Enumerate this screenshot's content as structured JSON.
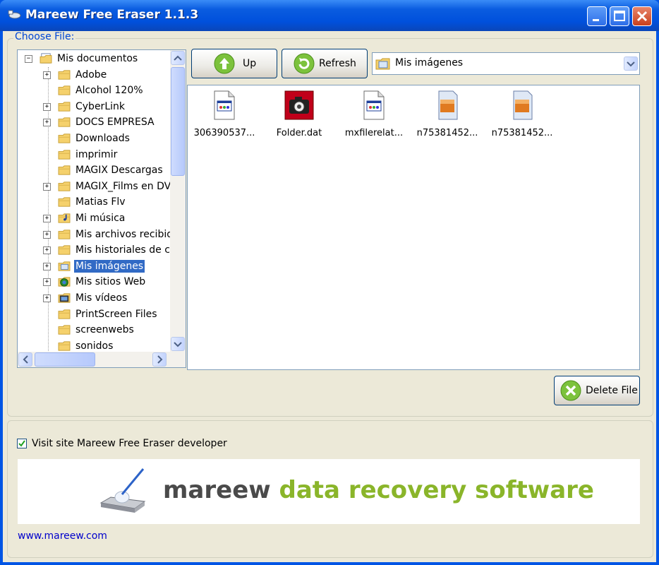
{
  "window": {
    "title": "Mareew Free Eraser 1.1.3"
  },
  "choose_file": {
    "label": "Choose File:"
  },
  "tree": {
    "items": [
      {
        "label": "Mis documentos",
        "level": 0,
        "expander": "minus",
        "icon": "my-documents-icon",
        "selected": false
      },
      {
        "label": "Adobe",
        "level": 1,
        "expander": "plus",
        "icon": "folder-icon",
        "selected": false
      },
      {
        "label": "Alcohol 120%",
        "level": 1,
        "expander": "none",
        "icon": "folder-icon",
        "selected": false
      },
      {
        "label": "CyberLink",
        "level": 1,
        "expander": "plus",
        "icon": "folder-icon",
        "selected": false
      },
      {
        "label": "DOCS EMPRESA",
        "level": 1,
        "expander": "plus",
        "icon": "folder-icon",
        "selected": false
      },
      {
        "label": "Downloads",
        "level": 1,
        "expander": "none",
        "icon": "folder-icon",
        "selected": false
      },
      {
        "label": "imprimir",
        "level": 1,
        "expander": "none",
        "icon": "folder-icon",
        "selected": false
      },
      {
        "label": "MAGIX Descargas",
        "level": 1,
        "expander": "none",
        "icon": "folder-icon",
        "selected": false
      },
      {
        "label": "MAGIX_Films en DV",
        "level": 1,
        "expander": "plus",
        "icon": "folder-icon",
        "selected": false
      },
      {
        "label": "Matias Flv",
        "level": 1,
        "expander": "none",
        "icon": "folder-icon",
        "selected": false
      },
      {
        "label": "Mi música",
        "level": 1,
        "expander": "plus",
        "icon": "music-folder-icon",
        "selected": false
      },
      {
        "label": "Mis archivos recibid",
        "level": 1,
        "expander": "plus",
        "icon": "folder-icon",
        "selected": false
      },
      {
        "label": "Mis historiales de c",
        "level": 1,
        "expander": "plus",
        "icon": "folder-icon",
        "selected": false
      },
      {
        "label": "Mis imágenes",
        "level": 1,
        "expander": "plus",
        "icon": "pictures-folder-icon",
        "selected": true
      },
      {
        "label": "Mis sitios Web",
        "level": 1,
        "expander": "plus",
        "icon": "web-folder-icon",
        "selected": false
      },
      {
        "label": "Mis vídeos",
        "level": 1,
        "expander": "plus",
        "icon": "video-folder-icon",
        "selected": false
      },
      {
        "label": "PrintScreen Files",
        "level": 1,
        "expander": "none",
        "icon": "folder-icon",
        "selected": false
      },
      {
        "label": "screenwebs",
        "level": 1,
        "expander": "none",
        "icon": "folder-icon",
        "selected": false
      },
      {
        "label": "sonidos",
        "level": 1,
        "expander": "none",
        "icon": "folder-icon",
        "selected": false
      }
    ]
  },
  "toolbar": {
    "up_label": "Up",
    "refresh_label": "Refresh"
  },
  "location": {
    "value": "Mis imágenes"
  },
  "files": [
    {
      "name": "306390537...",
      "icon": "document-icon"
    },
    {
      "name": "Folder.dat",
      "icon": "camera-icon"
    },
    {
      "name": "mxfilerelat...",
      "icon": "document-icon"
    },
    {
      "name": "n75381452...",
      "icon": "image-file-icon"
    },
    {
      "name": "n75381452...",
      "icon": "image-file-icon"
    }
  ],
  "actions": {
    "delete_label": "Delete File"
  },
  "footer": {
    "visit_checkbox_label": "Visit site Mareew Free Eraser developer",
    "visit_checked": true,
    "banner_brand": "mareew",
    "banner_tagline": "data recovery software",
    "link": "www.mareew.com"
  },
  "colors": {
    "accent": "#0055e5",
    "selection": "#316ac5",
    "brand_green": "#8ab52a",
    "brand_gray": "#4a4a4a"
  }
}
